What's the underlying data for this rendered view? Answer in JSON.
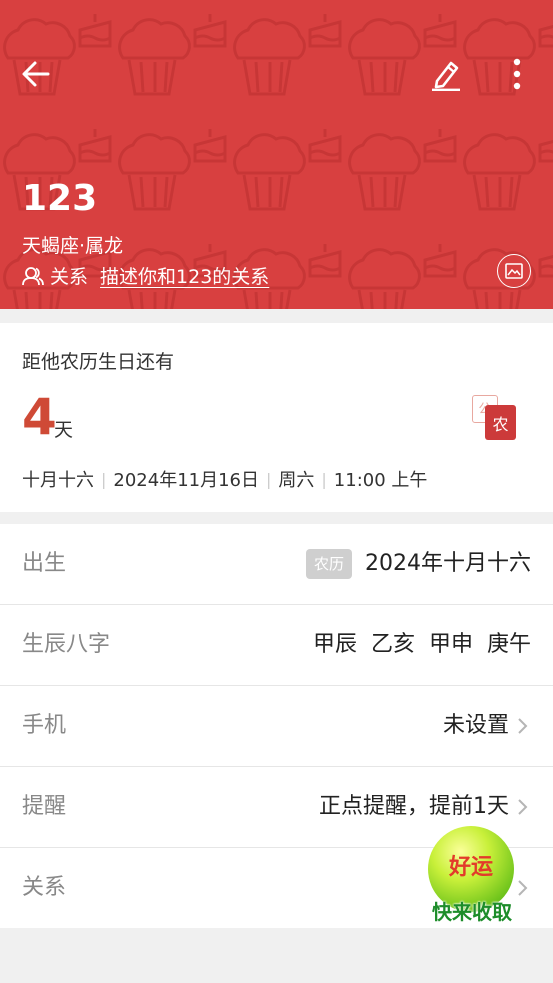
{
  "header": {
    "name": "123",
    "zodiac": "天蝎座·属龙",
    "relation_label": "关系",
    "relation_link": "描述你和123的关系"
  },
  "countdown": {
    "label": "距他农历生日还有",
    "days": "4",
    "unit": "天",
    "toggle_solar": "公",
    "toggle_lunar": "农",
    "lunar_date": "十月十六",
    "solar_date": "2024年11月16日",
    "weekday": "周六",
    "time": "11:00 上午"
  },
  "rows": {
    "birth": {
      "label": "出生",
      "badge": "农历",
      "value": "2024年十月十六"
    },
    "bazi": {
      "label": "生辰八字",
      "values": [
        "甲辰",
        "乙亥",
        "甲申",
        "庚午"
      ]
    },
    "phone": {
      "label": "手机",
      "value": "未设置"
    },
    "reminder": {
      "label": "提醒",
      "value": "正点提醒，提前1天"
    },
    "relation": {
      "label": "关系",
      "value": ""
    }
  },
  "lucky": {
    "ball_text": "好运",
    "caption": "快来收取"
  },
  "icons": {
    "back": "arrow-left-icon",
    "edit": "pencil-icon",
    "more": "more-vertical-icon",
    "relation": "people-icon",
    "background": "image-icon",
    "chevron": "chevron-right-icon"
  },
  "colors": {
    "header_bg": "#d84040",
    "accent": "#cf4a36",
    "lucky_green": "#1d8d2a"
  }
}
